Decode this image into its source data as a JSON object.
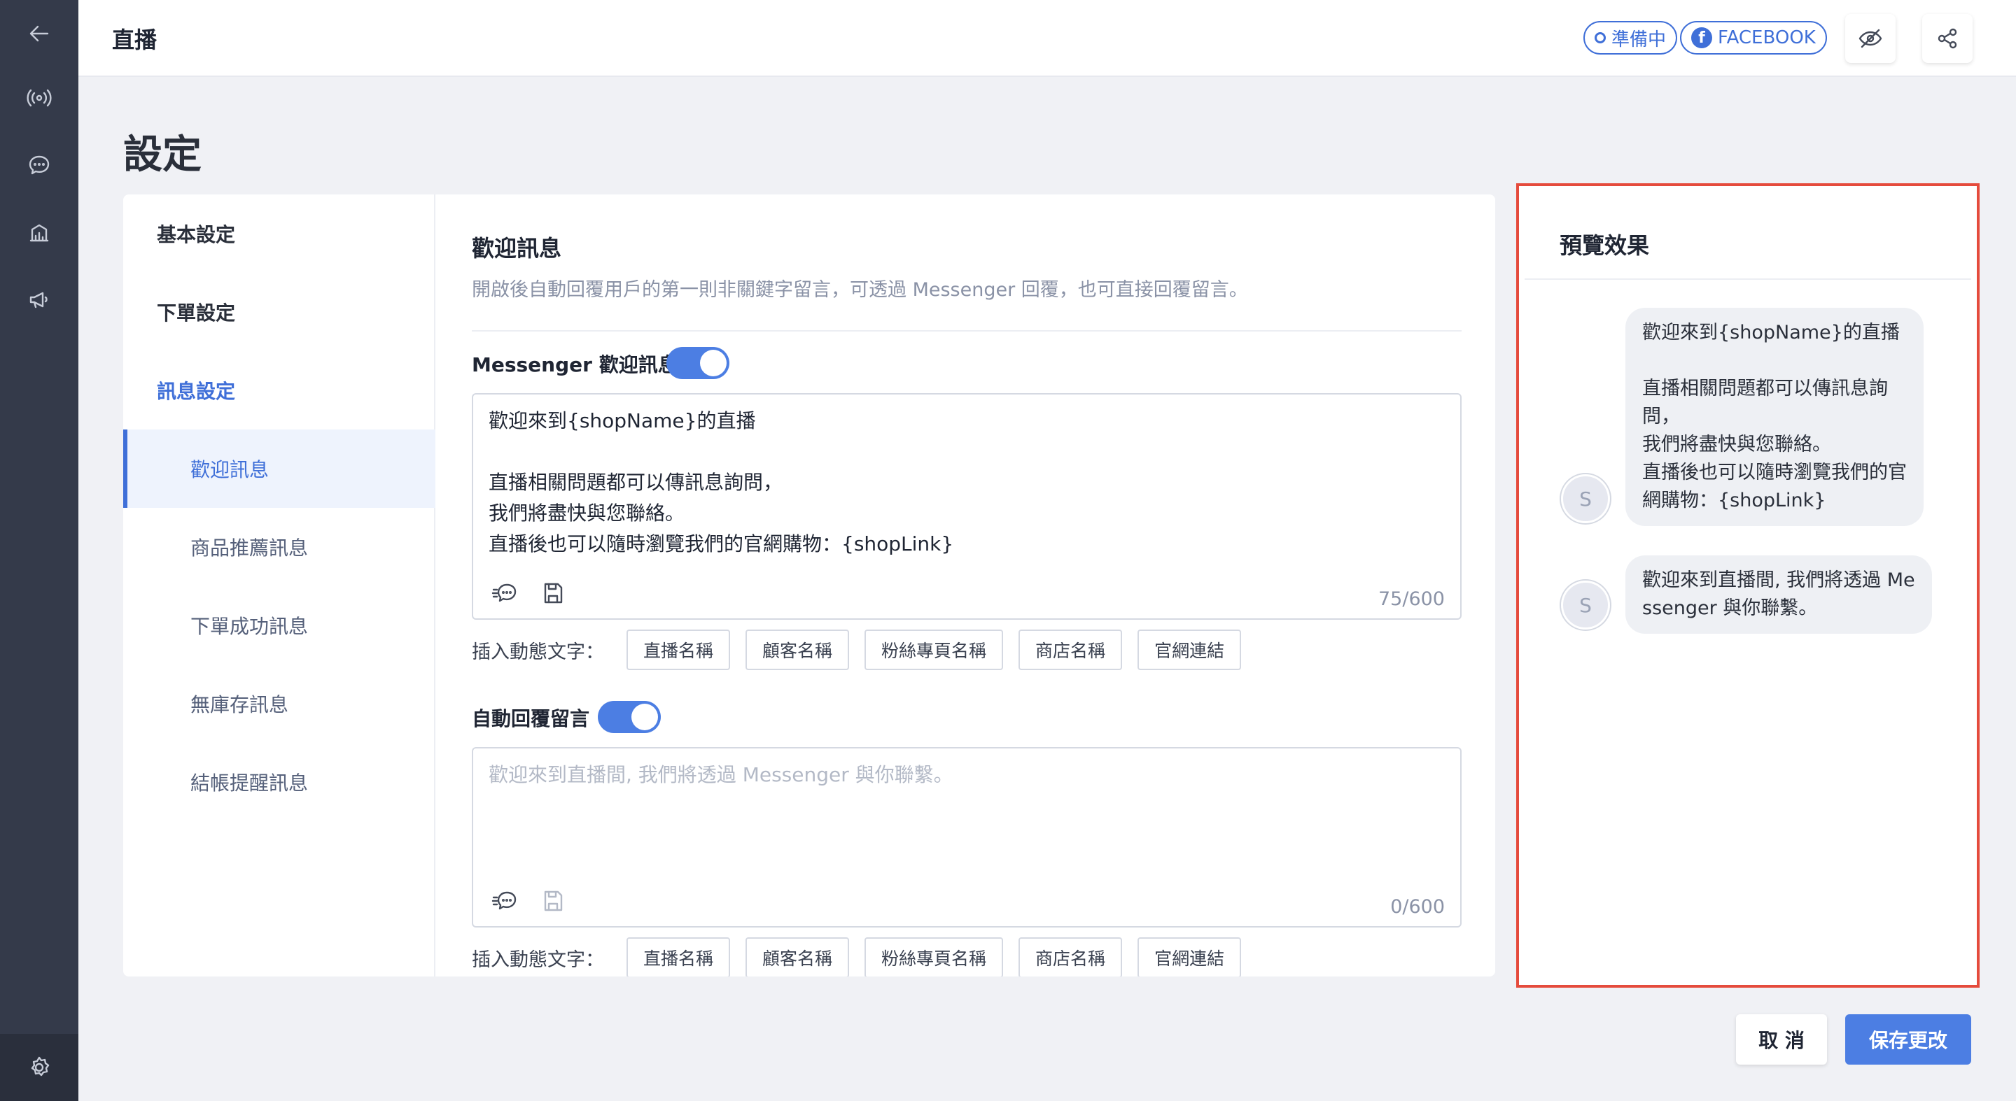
{
  "header": {
    "title": "直播",
    "status_pill": "準備中",
    "platform_pill": "FACEBOOK"
  },
  "page": {
    "title": "設定"
  },
  "nav": {
    "items": [
      {
        "label": "基本設定"
      },
      {
        "label": "下單設定"
      },
      {
        "label": "訊息設定"
      },
      {
        "label": "歡迎訊息"
      },
      {
        "label": "商品推薦訊息"
      },
      {
        "label": "下單成功訊息"
      },
      {
        "label": "無庫存訊息"
      },
      {
        "label": "結帳提醒訊息"
      }
    ]
  },
  "section": {
    "title": "歡迎訊息",
    "description": "開啟後自動回覆用戶的第一則非關鍵字留言，可透過 Messenger 回覆，也可直接回覆留言。"
  },
  "messenger": {
    "label": "Messenger 歡迎訊息",
    "enabled": true,
    "text": "歡迎來到{shopName}的直播\n\n直播相關問題都可以傳訊息詢問，\n我們將盡快與您聯絡。\n直播後也可以隨時瀏覽我們的官網購物：{shopLink}",
    "count": "75/600"
  },
  "comment": {
    "label": "自動回覆留言",
    "enabled": true,
    "placeholder": "歡迎來到直播間, 我們將透過 Messenger 與你聯繫。",
    "count": "0/600"
  },
  "insert": {
    "label": "插入動態文字：",
    "chips": [
      "直播名稱",
      "顧客名稱",
      "粉絲專頁名稱",
      "商店名稱",
      "官網連結"
    ]
  },
  "preview": {
    "title": "預覽效果",
    "avatar_letter": "S",
    "bubble1": "歡迎來到{shopName}的直播\n\n直播相關問題都可以傳訊息詢\n問，\n我們將盡快與您聯絡。\n直播後也可以隨時瀏覽我們的官\n網購物：{shopLink}",
    "bubble2": "歡迎來到直播間, 我們將透過 Me\nssenger 與你聯繫。"
  },
  "footer": {
    "cancel_label": "取 消",
    "save_label": "保存更改"
  },
  "colors": {
    "accent": "#4c7ee3",
    "highlight_border": "#e54b3c",
    "rail": "#343a4a"
  }
}
